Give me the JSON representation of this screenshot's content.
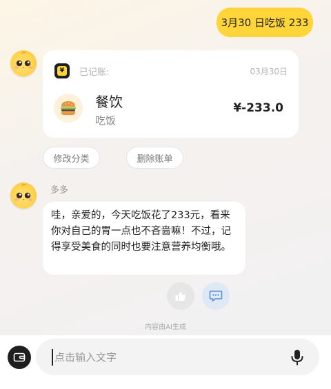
{
  "user_message": {
    "text": "3月30 日吃饭 233"
  },
  "bill_card": {
    "status": "已记账:",
    "date": "03月30日",
    "category": "餐饮",
    "note": "吃饭",
    "amount": "¥-233.0",
    "badge_icon": "yen-icon",
    "category_icon": "burger-icon"
  },
  "actions": {
    "edit_category": "修改分类",
    "delete_bill": "删除账单"
  },
  "bot": {
    "name": "多多",
    "message": "哇，亲爱的，今天吃饭花了233元，看来你对自己的胃一点也不吝啬嘛！不过，记得享受美食的同时也要注意营养均衡哦。"
  },
  "feedback": {
    "like_icon": "thumbs-up-icon",
    "comment_icon": "comment-icon"
  },
  "ai_note": "内容由AI生成",
  "input": {
    "placeholder": "点击输入文字",
    "value": ""
  },
  "colors": {
    "accent": "#ffd53a",
    "dark": "#1f1f1f",
    "comment_button_bg": "#dfe8f5",
    "comment_icon": "#5a8fd6"
  }
}
